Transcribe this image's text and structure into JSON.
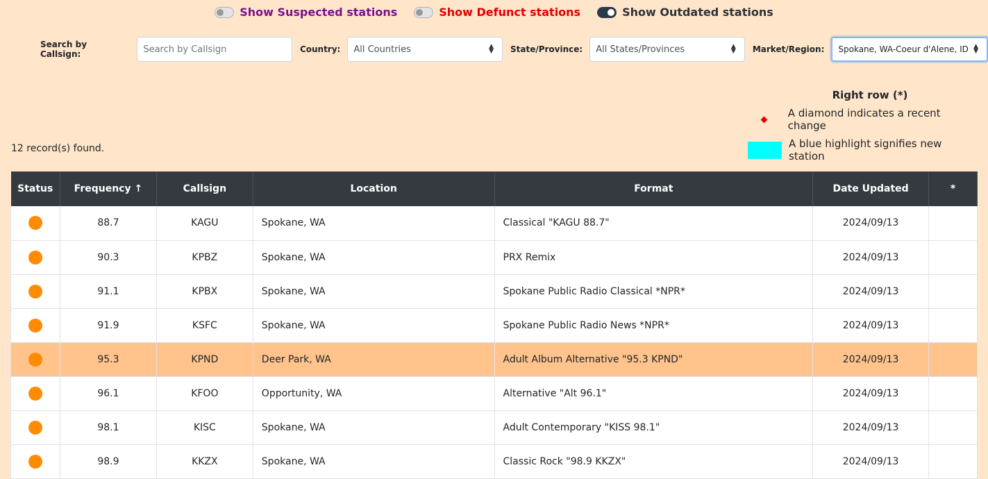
{
  "toggles": [
    {
      "label": "Show Suspected stations",
      "on": false
    },
    {
      "label": "Show Defunct stations",
      "on": false
    },
    {
      "label": "Show Outdated stations",
      "on": true
    }
  ],
  "filters": {
    "callsign_label": "Search by Callsign:",
    "callsign_placeholder": "Search by Callsign",
    "country_label": "Country:",
    "country_value": "All Countries",
    "state_label": "State/Province:",
    "state_value": "All States/Provinces",
    "market_label": "Market/Region:",
    "market_value": "Spokane, WA-Coeur d'Alene, ID"
  },
  "legend": {
    "title": "Right row (*)",
    "diamond_text": "A diamond indicates a recent change",
    "highlight_text": "A blue highlight signifies new station",
    "highlight_color": "#00ffff",
    "diamond_color": "#e00000"
  },
  "records_text": "12 record(s) found.",
  "table": {
    "headers": [
      "Status",
      "Frequency ↑",
      "Callsign",
      "Location",
      "Format",
      "Date Updated",
      "*"
    ],
    "rows": [
      {
        "status": "orange-dot",
        "frequency": "88.7",
        "callsign": "KAGU",
        "location": "Spokane, WA",
        "format": "Classical \"KAGU 88.7\"",
        "date": "2024/09/13",
        "star": ""
      },
      {
        "status": "orange-dot",
        "frequency": "90.3",
        "callsign": "KPBZ",
        "location": "Spokane, WA",
        "format": "PRX Remix",
        "date": "2024/09/13",
        "star": ""
      },
      {
        "status": "orange-dot",
        "frequency": "91.1",
        "callsign": "KPBX",
        "location": "Spokane, WA",
        "format": "Spokane Public Radio Classical *NPR*",
        "date": "2024/09/13",
        "star": ""
      },
      {
        "status": "orange-dot",
        "frequency": "91.9",
        "callsign": "KSFC",
        "location": "Spokane, WA",
        "format": "Spokane Public Radio News *NPR*",
        "date": "2024/09/13",
        "star": ""
      },
      {
        "status": "orange-dot",
        "frequency": "95.3",
        "callsign": "KPND",
        "location": "Deer Park, WA",
        "format": "Adult Album Alternative \"95.3 KPND\"",
        "date": "2024/09/13",
        "star": "",
        "highlight": true
      },
      {
        "status": "orange-dot",
        "frequency": "96.1",
        "callsign": "KFOO",
        "location": "Opportunity, WA",
        "format": "Alternative \"Alt 96.1\"",
        "date": "2024/09/13",
        "star": ""
      },
      {
        "status": "orange-dot",
        "frequency": "98.1",
        "callsign": "KISC",
        "location": "Spokane, WA",
        "format": "Adult Contemporary \"KISS 98.1\"",
        "date": "2024/09/13",
        "star": ""
      },
      {
        "status": "orange-dot",
        "frequency": "98.9",
        "callsign": "KKZX",
        "location": "Spokane, WA",
        "format": "Classic Rock \"98.9 KKZX\"",
        "date": "2024/09/13",
        "star": ""
      }
    ]
  },
  "colors": {
    "background": "#ffe6ca",
    "status_dot": "#ff8c00",
    "row_highlight": "#ffc38b",
    "header_bg": "#343a40"
  }
}
